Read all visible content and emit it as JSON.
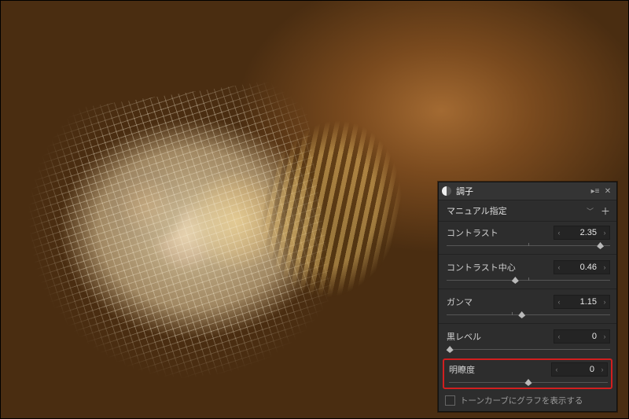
{
  "panel": {
    "title": "調子",
    "dropdown_value": "マニュアル指定",
    "sliders": {
      "contrast": {
        "label": "コントラスト",
        "value": "2.35",
        "thumb_pct": 94,
        "notch_pct": 50
      },
      "contrast_center": {
        "label": "コントラスト中心",
        "value": "0.46",
        "thumb_pct": 42,
        "notch_pct": 50
      },
      "gamma": {
        "label": "ガンマ",
        "value": "1.15",
        "thumb_pct": 46,
        "notch_pct": 40
      },
      "black_level": {
        "label": "黒レベル",
        "value": "0",
        "thumb_pct": 2,
        "notch_pct": null
      },
      "clarity": {
        "label": "明瞭度",
        "value": "0",
        "thumb_pct": 50,
        "notch_pct": 50
      }
    },
    "tone_curve_checkbox_label": "トーンカーブにグラフを表示する"
  }
}
